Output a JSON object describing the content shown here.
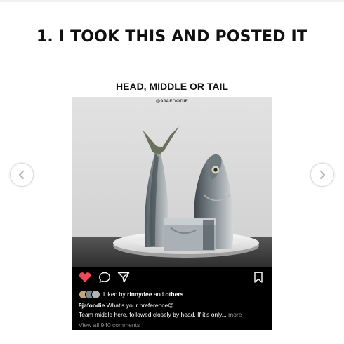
{
  "slide": {
    "title": "1. I TOOK THIS AND POSTED IT"
  },
  "navigation": {
    "prev_icon": "chevron-left-icon",
    "next_icon": "chevron-right-icon"
  },
  "post": {
    "image_title": "HEAD, MIDDLE OR TAIL",
    "watermark": "@9JAFOODIE",
    "actions": {
      "like_icon": "heart-icon",
      "comment_icon": "comment-icon",
      "share_icon": "share-icon",
      "save_icon": "bookmark-icon",
      "like_color": "#ed4956"
    },
    "likes": {
      "prefix": "Liked by ",
      "user": "rinnydee",
      "middle": " and ",
      "others": "others"
    },
    "caption": {
      "username": "9jafoodie",
      "text": " What's your preference",
      "emoji": "😉",
      "line2": "Team middle here, followed closely by head. If it's only... ",
      "more": "more"
    },
    "comments_link": "View all 940 comments"
  }
}
